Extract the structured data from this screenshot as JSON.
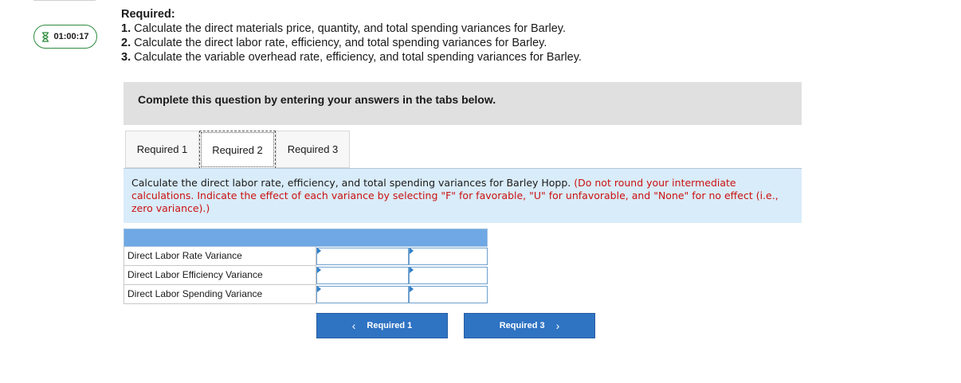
{
  "timer": {
    "value": "01:00:17",
    "icon": "hourglass-icon"
  },
  "required": {
    "heading": "Required:",
    "items": [
      {
        "num": "1.",
        "text": "Calculate the direct materials price, quantity, and total spending variances for Barley."
      },
      {
        "num": "2.",
        "text": "Calculate the direct labor rate, efficiency, and total spending variances for Barley."
      },
      {
        "num": "3.",
        "text": "Calculate the variable overhead rate, efficiency, and total spending variances for Barley."
      }
    ]
  },
  "instruction": "Complete this question by entering your answers in the tabs below.",
  "tabs": [
    {
      "label": "Required 1",
      "active": false
    },
    {
      "label": "Required 2",
      "active": true
    },
    {
      "label": "Required 3",
      "active": false
    }
  ],
  "prompt": {
    "main": "Calculate the direct labor rate, efficiency, and total spending variances for Barley Hopp.",
    "note": "(Do not round your intermediate calculations. Indicate the effect of each variance by selecting \"F\" for favorable, \"U\" for unfavorable, and \"None\" for no effect (i.e., zero variance).)"
  },
  "table": {
    "rows": [
      {
        "label": "Direct Labor Rate Variance",
        "amount": "",
        "effect": ""
      },
      {
        "label": "Direct Labor Efficiency Variance",
        "amount": "",
        "effect": ""
      },
      {
        "label": "Direct Labor Spending Variance",
        "amount": "",
        "effect": ""
      }
    ]
  },
  "nav": {
    "prev_label": "Required 1",
    "next_label": "Required 3"
  },
  "colors": {
    "button_blue": "#2f73c3",
    "table_header_blue": "#6fa8e4",
    "prompt_bg": "#d9ecf9",
    "instruction_bg": "#e0e0e0",
    "note_red": "#cc1111",
    "timer_green": "#2e8b3e"
  }
}
